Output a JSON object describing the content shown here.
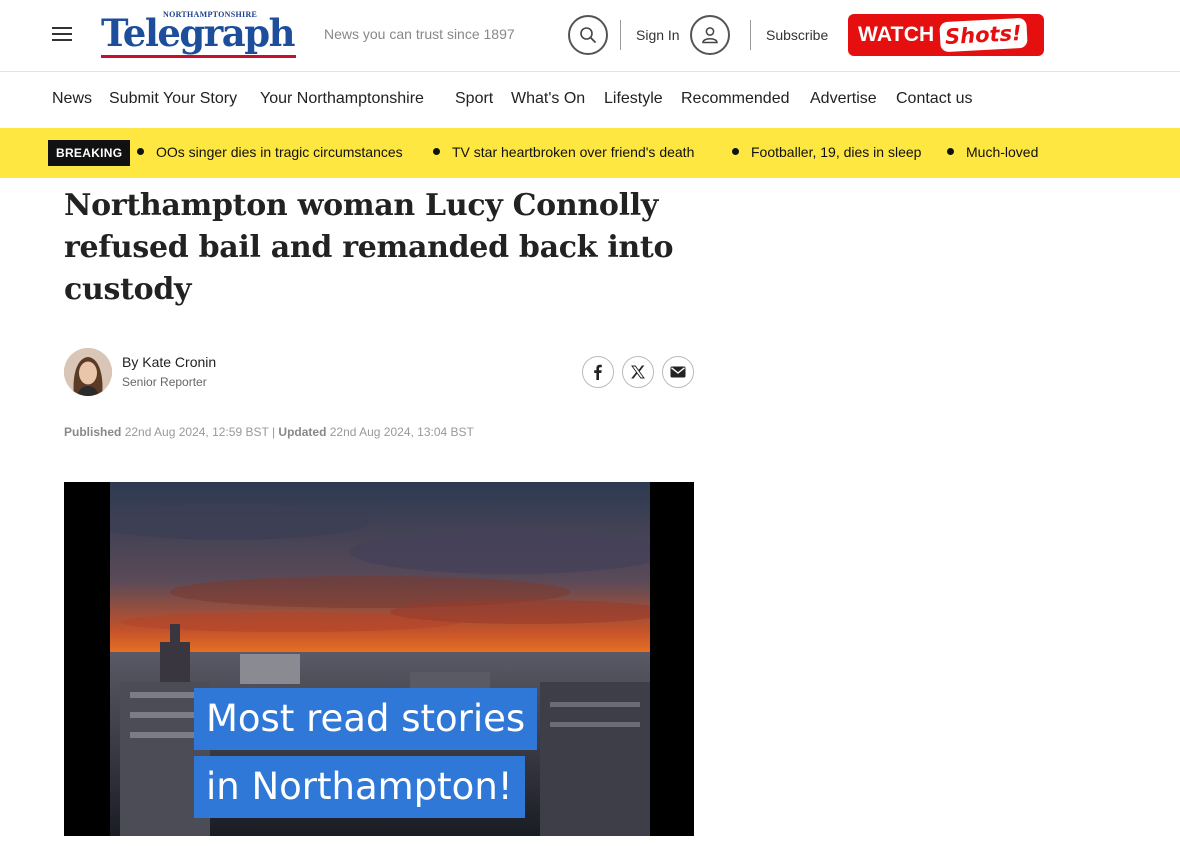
{
  "header": {
    "logo_small": "NORTHAMPTONSHIRE",
    "logo_main": "Telegraph",
    "tagline": "News you can trust since 1897",
    "sign_in": "Sign In",
    "subscribe": "Subscribe",
    "watch_label": "WATCH",
    "shots_label": "Shots!",
    "icons": [
      "menu-icon",
      "search-icon",
      "user-icon"
    ]
  },
  "nav": {
    "items": [
      "News",
      "Submit Your Story",
      "Your Northamptonshire",
      "Sport",
      "What's On",
      "Lifestyle",
      "Recommended",
      "Advertise",
      "Contact us"
    ]
  },
  "breaking": {
    "label": "BREAKING",
    "items": [
      "OOs singer dies in tragic circumstances",
      "TV star heartbroken over friend's death",
      "Footballer, 19, dies in sleep",
      "Much-loved"
    ]
  },
  "article": {
    "headline": "Northampton woman Lucy Connolly refused bail and remanded back into custody",
    "author": "By Kate Cronin",
    "role": "Senior Reporter",
    "published_label": "Published",
    "published_date": "22nd Aug 2024, 12:59 BST",
    "separator": "|",
    "updated_label": "Updated",
    "updated_date": "22nd Aug 2024, 13:04 BST",
    "share_icons": [
      "facebook-icon",
      "x-icon",
      "email-icon"
    ]
  },
  "video": {
    "caption_line1": "Most read stories",
    "caption_line2": "in Northampton!"
  },
  "colors": {
    "brand_blue": "#1c4e9c",
    "brand_red": "#e60f0f",
    "breaking_yellow": "#fde740",
    "caption_blue": "#2f78d8"
  }
}
